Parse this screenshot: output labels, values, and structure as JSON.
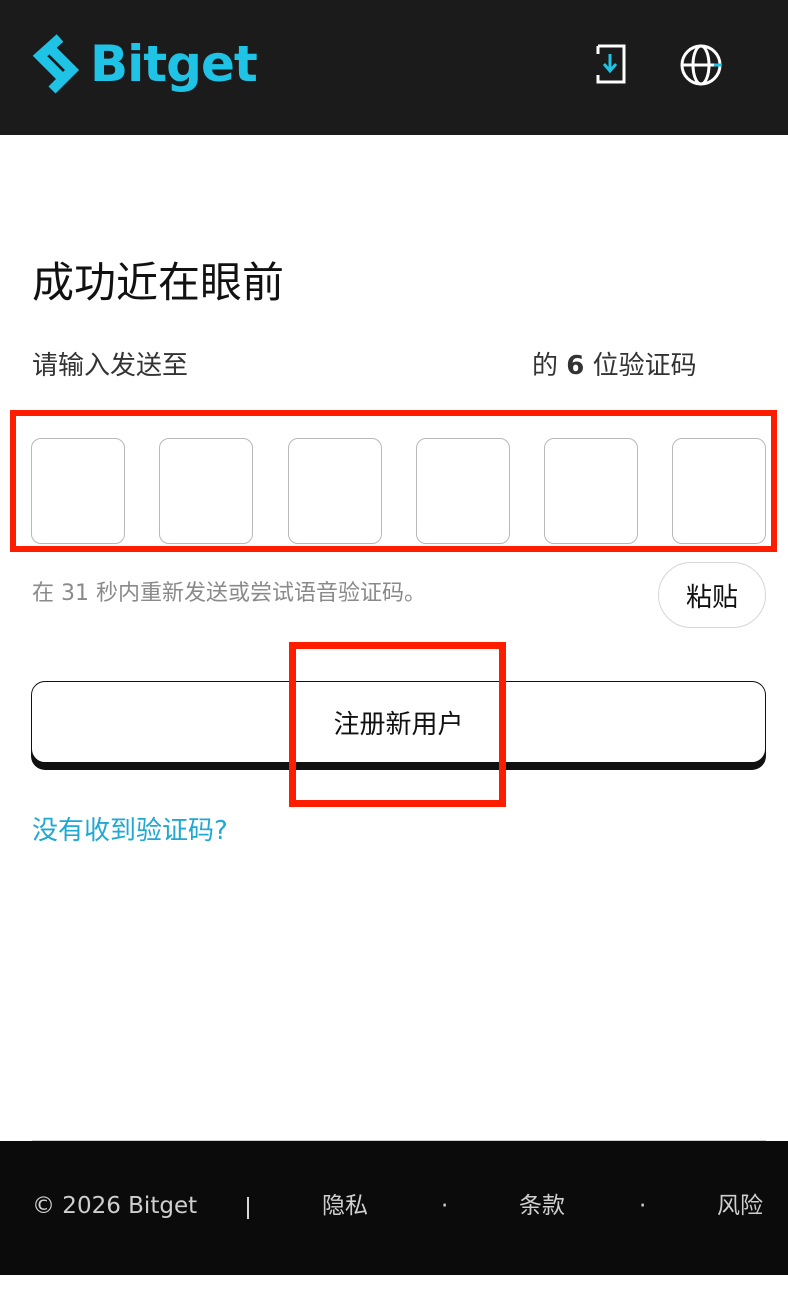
{
  "header": {
    "logo_text": "Bitget",
    "brand_color": "#1fc3e6",
    "icons": [
      "download-icon",
      "globe-icon"
    ]
  },
  "main": {
    "title": "成功近在眼前",
    "instruction_prefix": "请输入发送至",
    "instruction_suffix_before": "的",
    "code_length": "6",
    "instruction_suffix_after": "位验证码",
    "otp_boxes": [
      "",
      "",
      "",
      "",
      "",
      ""
    ],
    "resend_text": "在 31 秒内重新发送或尝试语音验证码。",
    "paste_label": "粘贴",
    "register_label": "注册新用户",
    "no_code_link": "没有收到验证码?",
    "link_color": "#1fa8d4",
    "highlight_color": "#ff1d00"
  },
  "footer": {
    "copyright": "© 2026 Bitget",
    "privacy": "隐私",
    "terms": "条款",
    "risk": "风险",
    "dot": "·"
  }
}
